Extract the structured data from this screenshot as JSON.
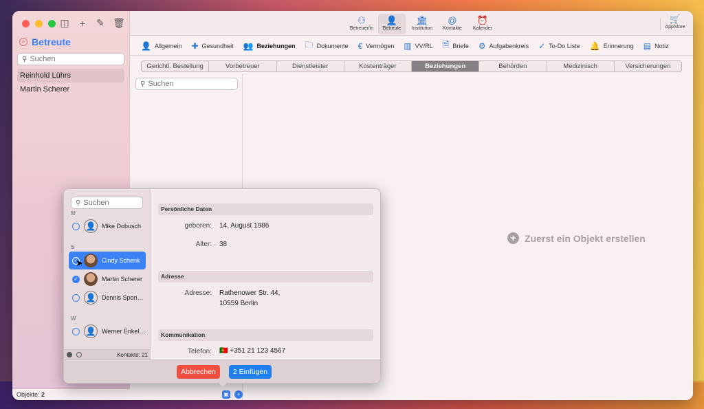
{
  "sidebar": {
    "title": "Betreute",
    "search_placeholder": "Suchen",
    "items": [
      {
        "label": "Reinhold Lührs",
        "selected": true
      },
      {
        "label": "Martin Scherer",
        "selected": false
      }
    ],
    "footer_label": "Objekte:",
    "footer_count": "2"
  },
  "toolbar": {
    "buttons": [
      {
        "label": "Betreuer/in",
        "icon": "person-network-icon"
      },
      {
        "label": "Betreute",
        "icon": "person-icon"
      },
      {
        "label": "Institution",
        "icon": "building-icon"
      },
      {
        "label": "Kontakte",
        "icon": "at-icon"
      },
      {
        "label": "Kalender",
        "icon": "alarm-icon"
      }
    ],
    "appstore_label": "AppStore"
  },
  "tabs_main": [
    {
      "label": "Allgemein",
      "icon": "person-icon"
    },
    {
      "label": "Gesundheit",
      "icon": "medical-case-icon"
    },
    {
      "label": "Beziehungen",
      "icon": "people-icon",
      "selected": true
    },
    {
      "label": "Dokumente",
      "icon": "folder-icon"
    },
    {
      "label": "Vermögen",
      "icon": "euro-icon"
    },
    {
      "label": "VV/RL",
      "icon": "books-icon"
    },
    {
      "label": "Briefe",
      "icon": "document-icon"
    },
    {
      "label": "Aufgabenkreis",
      "icon": "gear-clock-icon"
    },
    {
      "label": "To-Do Liste",
      "icon": "checkmark-circle-icon"
    },
    {
      "label": "Erinnerung",
      "icon": "bell-icon"
    },
    {
      "label": "Notiz",
      "icon": "note-icon"
    }
  ],
  "tabs_sub": [
    {
      "label": "Gerichtl. Bestellung"
    },
    {
      "label": "Vorbetreuer"
    },
    {
      "label": "Dienstleister"
    },
    {
      "label": "Kostenträger"
    },
    {
      "label": "Beziehungen",
      "selected": true
    },
    {
      "label": "Behörden"
    },
    {
      "label": "Medizinisch"
    },
    {
      "label": "Versicherungen"
    }
  ],
  "list_search_placeholder": "Suchen",
  "empty_message": "Zuerst ein Objekt erstellen",
  "popover": {
    "search_placeholder": "Suchen",
    "sections": [
      {
        "letter": "M",
        "contacts": [
          {
            "name": "Mike Dobusch",
            "checked": false,
            "selected": false
          }
        ]
      },
      {
        "letter": "S",
        "contacts": [
          {
            "name": "Cindy Schenk",
            "checked": true,
            "selected": true
          },
          {
            "name": "Martin Scherer",
            "checked": true,
            "selected": false
          },
          {
            "name": "Dennis Spon…",
            "checked": false,
            "selected": false
          }
        ]
      },
      {
        "letter": "W",
        "contacts": [
          {
            "name": "Werner Enkel…",
            "checked": false,
            "selected": false
          }
        ]
      }
    ],
    "footer_count": "Kontakte: 21",
    "details": {
      "personal_header": "Persönliche Daten",
      "born_label": "geboren:",
      "born_value": "14. August 1986",
      "age_label": "Alter:",
      "age_value": "38",
      "address_header": "Adresse",
      "address_label": "Adresse:",
      "address_line1": "Rathenower Str. 44,",
      "address_line2": "10559 Berlin",
      "comm_header": "Kommunikation",
      "phone_label": "Telefon:",
      "phone_flag": "🇵🇹",
      "phone_value": "+351 21 123 4567"
    },
    "cancel_label": "Abbrechen",
    "insert_label": "2 Einfügen"
  },
  "colors": {
    "accent": "#3a82f6",
    "danger": "#f24e3f",
    "primary_button": "#1f7ff0"
  }
}
